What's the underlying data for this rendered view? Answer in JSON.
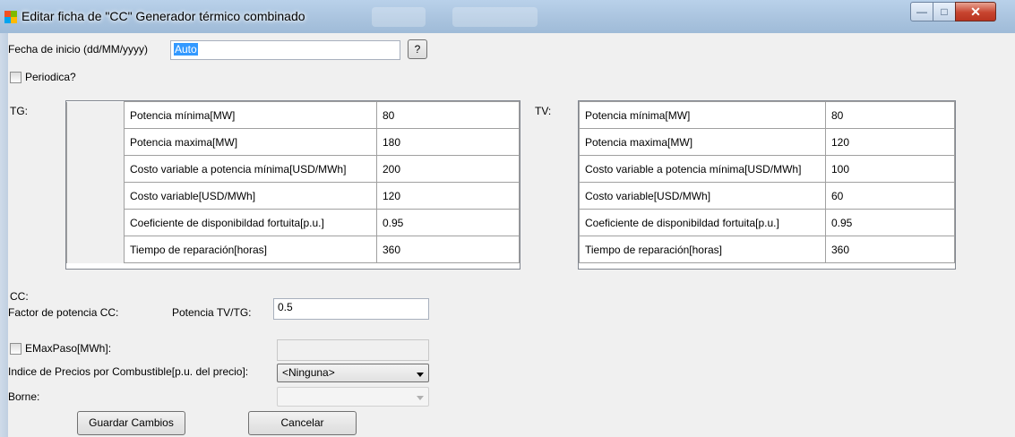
{
  "window": {
    "title": "Editar ficha de  \"CC\" Generador térmico combinado",
    "minimize": "—",
    "maximize": "□",
    "close": "✕"
  },
  "fecha": {
    "label": "Fecha de inicio (dd/MM/yyyy)",
    "value": "Auto",
    "help": "?"
  },
  "periodica": {
    "label": "Periodica?",
    "checked": false
  },
  "tg": {
    "label": "TG:",
    "rows": [
      {
        "name": "Potencia mínima[MW]",
        "value": "80"
      },
      {
        "name": "Potencia maxima[MW]",
        "value": "180"
      },
      {
        "name": "Costo variable a potencia mínima[USD/MWh]",
        "value": "200"
      },
      {
        "name": "Costo variable[USD/MWh]",
        "value": "120"
      },
      {
        "name": "Coeficiente de disponibildad fortuita[p.u.]",
        "value": "0.95"
      },
      {
        "name": "Tiempo de reparación[horas]",
        "value": "360"
      }
    ]
  },
  "tv": {
    "label": "TV:",
    "rows": [
      {
        "name": "Potencia mínima[MW]",
        "value": "80"
      },
      {
        "name": "Potencia maxima[MW]",
        "value": "120"
      },
      {
        "name": "Costo variable a potencia mínima[USD/MWh]",
        "value": "100"
      },
      {
        "name": "Costo variable[USD/MWh]",
        "value": "60"
      },
      {
        "name": "Coeficiente de disponibildad fortuita[p.u.]",
        "value": "0.95"
      },
      {
        "name": "Tiempo de reparación[horas]",
        "value": "360"
      }
    ]
  },
  "cc": {
    "label": "CC:",
    "factor_label": "Factor de potencia CC:",
    "ratio_label": "Potencia TV/TG:",
    "ratio_value": "0.5"
  },
  "emax": {
    "label": "EMaxPaso[MWh]:",
    "checked": false,
    "value": ""
  },
  "indice": {
    "label": "Indice de Precios por Combustible[p.u. del precio]:",
    "selected": "<Ninguna>"
  },
  "borne": {
    "label": "Borne:",
    "selected": ""
  },
  "buttons": {
    "save": "Guardar Cambios",
    "cancel": "Cancelar"
  },
  "colors": {
    "selection": "#3399ff",
    "close_button": "#c7442f",
    "window_bg": "#f0f0f0"
  }
}
